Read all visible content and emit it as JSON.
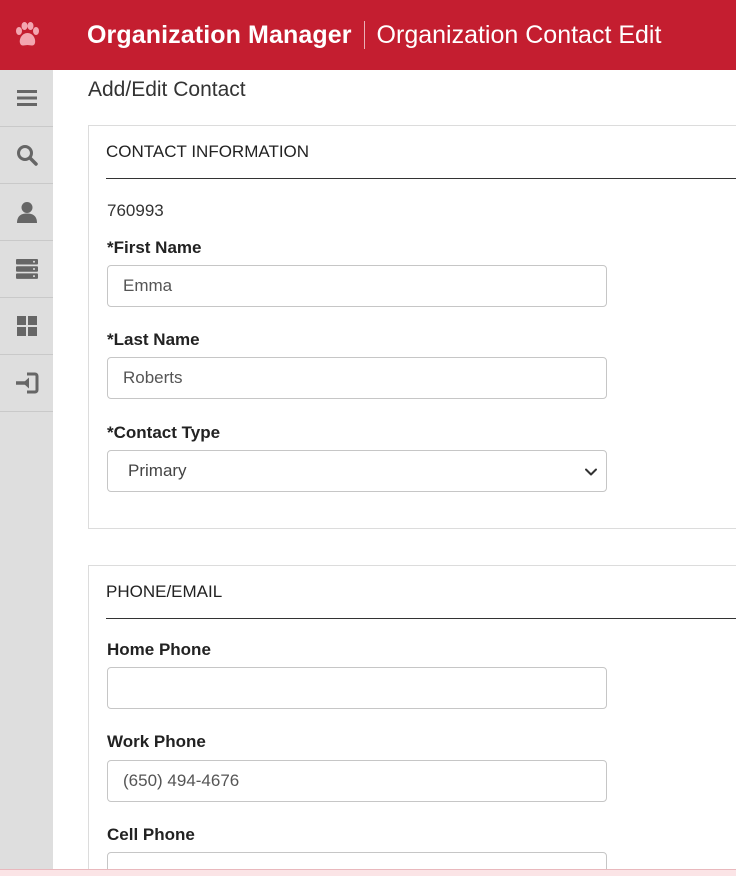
{
  "header": {
    "app_title": "Organization Manager",
    "page_subtitle": "Organization Contact Edit",
    "logo_icon": "paw-icon",
    "brand_color": "#c41e30"
  },
  "sidebar": {
    "items": [
      {
        "icon": "menu-icon"
      },
      {
        "icon": "search-icon"
      },
      {
        "icon": "user-icon"
      },
      {
        "icon": "server-icon"
      },
      {
        "icon": "dashboard-icon"
      },
      {
        "icon": "sign-in-icon"
      }
    ]
  },
  "main": {
    "page_title": "Add/Edit Contact",
    "contact_info": {
      "section_title": "CONTACT INFORMATION",
      "contact_id": "760993",
      "first_name_label": "*First Name",
      "first_name_value": "Emma",
      "last_name_label": "*Last Name",
      "last_name_value": "Roberts",
      "contact_type_label": "*Contact Type",
      "contact_type_value": "Primary"
    },
    "phone_email": {
      "section_title": "PHONE/EMAIL",
      "home_phone_label": "Home Phone",
      "home_phone_value": "",
      "work_phone_label": "Work Phone",
      "work_phone_value": "(650) 494-4676",
      "cell_phone_label": "Cell Phone",
      "cell_phone_value": ""
    }
  }
}
